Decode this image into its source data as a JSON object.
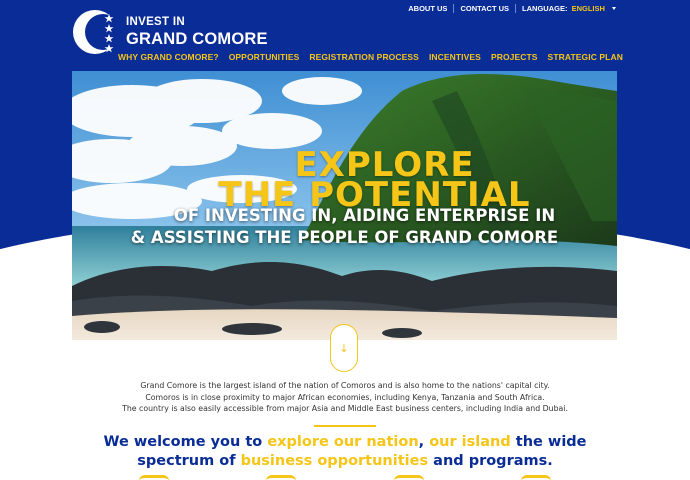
{
  "brand": {
    "line1": "INVEST IN",
    "line2": "GRAND COMORE"
  },
  "utility_nav": {
    "about": "ABOUT US",
    "contact": "CONTACT US",
    "language_label": "LANGUAGE:",
    "language_value": "ENGLISH"
  },
  "main_nav": {
    "items": [
      {
        "label": "WHY GRAND COMORE?"
      },
      {
        "label": "OPPORTUNITIES"
      },
      {
        "label": "REGISTRATION PROCESS"
      },
      {
        "label": "INCENTIVES"
      },
      {
        "label": "PROJECTS"
      },
      {
        "label": "STRATEGIC PLAN"
      }
    ]
  },
  "hero": {
    "line1": "EXPLORE",
    "line2": "THE POTENTIAL",
    "line3": "OF INVESTING IN, AIDING ENTERPRISE IN",
    "line4": "& ASSISTING THE PEOPLE OF GRAND COMORE"
  },
  "scroll_button": {
    "glyph": "↓"
  },
  "intro": {
    "p1": "Grand Comore is the largest island of the nation of Comoros and is also home to the nations' capital city.",
    "p2": "Comoros is in close proximity to major African economies, including Kenya, Tanzania and South Africa.",
    "p3": "The country is also easily accessible from major Asia and Middle East business centers, including India and Dubai."
  },
  "welcome": {
    "a": "We welcome you to ",
    "b": "explore our nation",
    "c": ", ",
    "d": "our island",
    "e": " the wide",
    "f": "spectrum of ",
    "g": "business opportunities",
    "h": " and programs."
  },
  "colors": {
    "brand_blue": "#0a2c96",
    "accent_yellow": "#f5c518"
  }
}
